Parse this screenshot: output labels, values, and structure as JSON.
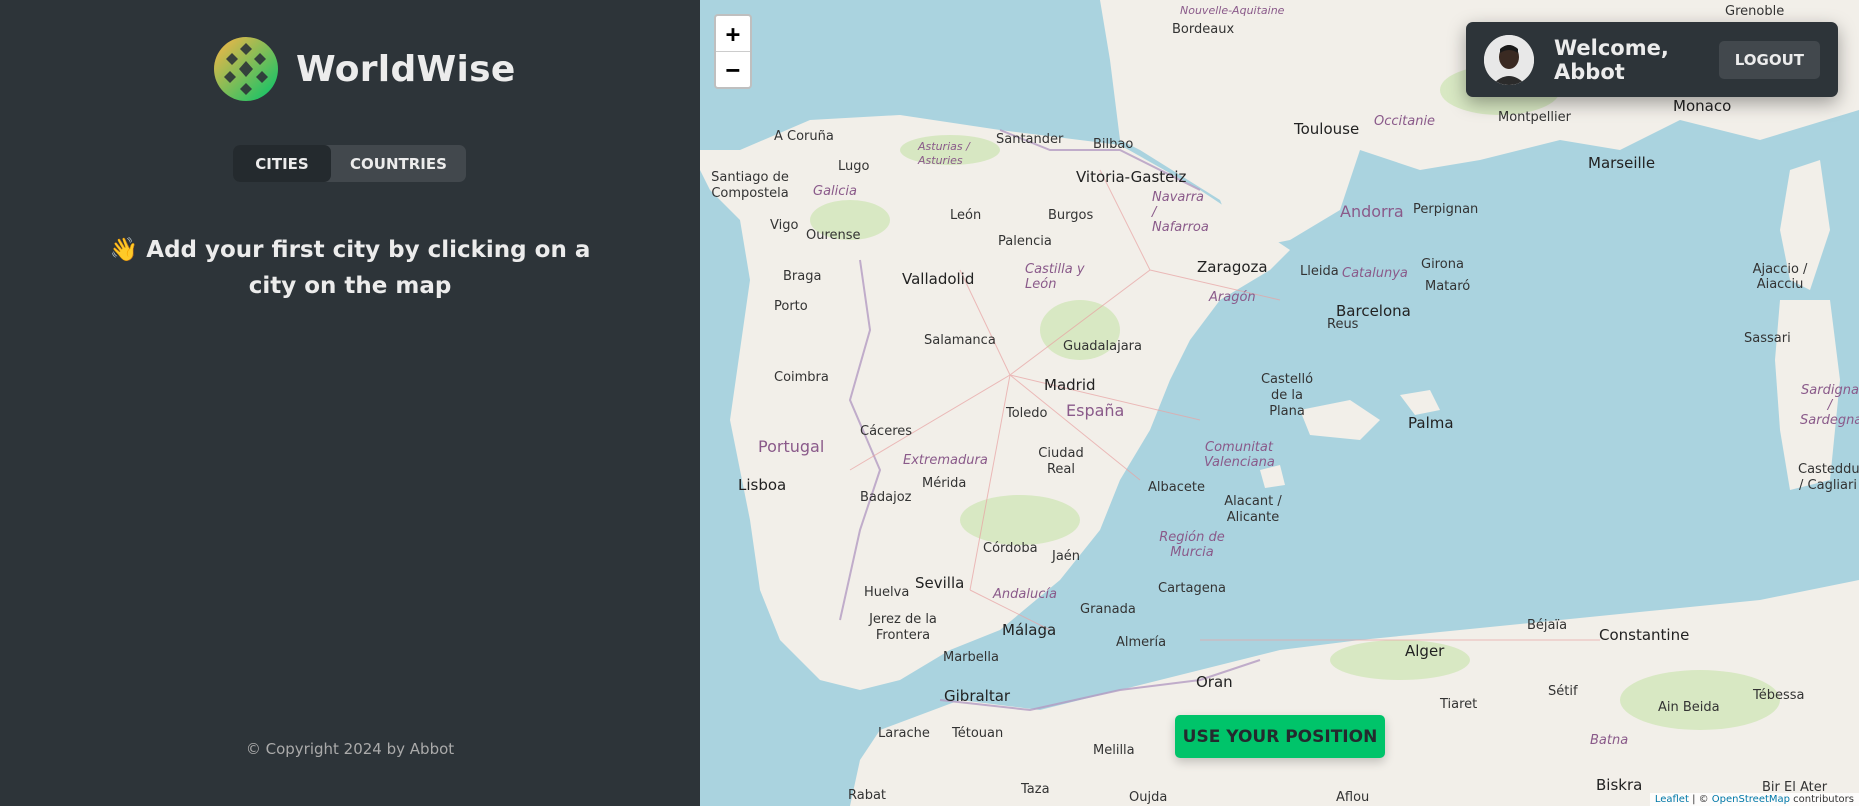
{
  "app": {
    "name": "WorldWise"
  },
  "tabs": [
    {
      "label": "Cities",
      "active": true
    },
    {
      "label": "Countries",
      "active": false
    }
  ],
  "message": {
    "emoji": "👋",
    "text": "Add your first city by clicking on a city on the map"
  },
  "footer": {
    "copyright": "© Copyright 2024 by Abbot"
  },
  "zoom": {
    "in_label": "+",
    "out_label": "−"
  },
  "user": {
    "welcome": "Welcome, Abbot",
    "logout_label": "Logout"
  },
  "position_button": {
    "label": "Use your position"
  },
  "attribution": {
    "leaflet": "Leaflet",
    "separator": " | © ",
    "osm": "OpenStreetMap",
    "suffix": " contributors"
  },
  "colors": {
    "sidebar_bg": "#2d3439",
    "tab_active_bg": "#242a2e",
    "brand_green": "#00c46a",
    "sea": "#aad3df",
    "land": "#f2efe9"
  },
  "map_labels": [
    {
      "text": "Bordeaux",
      "kind": "city"
    },
    {
      "text": "Nouvelle-Aquitaine",
      "kind": "region"
    },
    {
      "text": "Toulouse",
      "kind": "city"
    },
    {
      "text": "Occitanie",
      "kind": "region"
    },
    {
      "text": "Montpellier",
      "kind": "city"
    },
    {
      "text": "Marseille",
      "kind": "big"
    },
    {
      "text": "Monaco",
      "kind": "city"
    },
    {
      "text": "Grenoble",
      "kind": "city"
    },
    {
      "text": "A Coruña",
      "kind": "city"
    },
    {
      "text": "Lugo",
      "kind": "city"
    },
    {
      "text": "Santiago de Compostela",
      "kind": "city"
    },
    {
      "text": "Galicia",
      "kind": "region"
    },
    {
      "text": "Vigo",
      "kind": "city"
    },
    {
      "text": "Ourense",
      "kind": "city"
    },
    {
      "text": "Asturias / Asturies",
      "kind": "region"
    },
    {
      "text": "Santander",
      "kind": "city"
    },
    {
      "text": "Bilbao",
      "kind": "city"
    },
    {
      "text": "Vitoria-Gasteiz",
      "kind": "big"
    },
    {
      "text": "Navarra / Nafarroa",
      "kind": "region"
    },
    {
      "text": "Andorra",
      "kind": "country"
    },
    {
      "text": "Perpignan",
      "kind": "city"
    },
    {
      "text": "León",
      "kind": "city"
    },
    {
      "text": "Burgos",
      "kind": "city"
    },
    {
      "text": "Palencia",
      "kind": "city"
    },
    {
      "text": "Valladolid",
      "kind": "big"
    },
    {
      "text": "Castilla y León",
      "kind": "region"
    },
    {
      "text": "Zaragoza",
      "kind": "big"
    },
    {
      "text": "Aragón",
      "kind": "region"
    },
    {
      "text": "Lleida",
      "kind": "city"
    },
    {
      "text": "Catalunya",
      "kind": "region"
    },
    {
      "text": "Girona",
      "kind": "city"
    },
    {
      "text": "Mataró",
      "kind": "city"
    },
    {
      "text": "Barcelona",
      "kind": "big"
    },
    {
      "text": "Reus",
      "kind": "city"
    },
    {
      "text": "Braga",
      "kind": "city"
    },
    {
      "text": "Porto",
      "kind": "city"
    },
    {
      "text": "Salamanca",
      "kind": "city"
    },
    {
      "text": "Guadalajara",
      "kind": "city"
    },
    {
      "text": "Madrid",
      "kind": "big"
    },
    {
      "text": "España",
      "kind": "country"
    },
    {
      "text": "Toledo",
      "kind": "city"
    },
    {
      "text": "Coimbra",
      "kind": "city"
    },
    {
      "text": "Portugal",
      "kind": "country"
    },
    {
      "text": "Cáceres",
      "kind": "city"
    },
    {
      "text": "Extremadura",
      "kind": "region"
    },
    {
      "text": "Lisboa",
      "kind": "big"
    },
    {
      "text": "Mérida",
      "kind": "city"
    },
    {
      "text": "Badajoz",
      "kind": "city"
    },
    {
      "text": "Ciudad Real",
      "kind": "city"
    },
    {
      "text": "Castelló de la Plana",
      "kind": "city"
    },
    {
      "text": "Comunitat Valenciana",
      "kind": "region"
    },
    {
      "text": "Albacete",
      "kind": "city"
    },
    {
      "text": "Alacant / Alicante",
      "kind": "city"
    },
    {
      "text": "Palma",
      "kind": "big"
    },
    {
      "text": "Córdoba",
      "kind": "city"
    },
    {
      "text": "Jaén",
      "kind": "city"
    },
    {
      "text": "Región de Murcia",
      "kind": "region"
    },
    {
      "text": "Sevilla",
      "kind": "big"
    },
    {
      "text": "Andalucía",
      "kind": "region"
    },
    {
      "text": "Huelva",
      "kind": "city"
    },
    {
      "text": "Granada",
      "kind": "city"
    },
    {
      "text": "Cartagena",
      "kind": "city"
    },
    {
      "text": "Jerez de la Frontera",
      "kind": "city"
    },
    {
      "text": "Málaga",
      "kind": "big"
    },
    {
      "text": "Almería",
      "kind": "city"
    },
    {
      "text": "Marbella",
      "kind": "city"
    },
    {
      "text": "Gibraltar",
      "kind": "big"
    },
    {
      "text": "Larache",
      "kind": "city"
    },
    {
      "text": "Tétouan",
      "kind": "city"
    },
    {
      "text": "Melilla",
      "kind": "city"
    },
    {
      "text": "Oran",
      "kind": "big"
    },
    {
      "text": "Alger",
      "kind": "big"
    },
    {
      "text": "Constantine",
      "kind": "big"
    },
    {
      "text": "Béjaïa",
      "kind": "city"
    },
    {
      "text": "Sétif",
      "kind": "city"
    },
    {
      "text": "Tiaret",
      "kind": "city"
    },
    {
      "text": "Ain Beida",
      "kind": "city"
    },
    {
      "text": "Tébessa",
      "kind": "city"
    },
    {
      "text": "Batna",
      "kind": "region"
    },
    {
      "text": "Biskra",
      "kind": "city"
    },
    {
      "text": "Bir El Ater",
      "kind": "city"
    },
    {
      "text": "Rabat",
      "kind": "city"
    },
    {
      "text": "Taza",
      "kind": "city"
    },
    {
      "text": "Oujda",
      "kind": "city"
    },
    {
      "text": "Aflou",
      "kind": "city"
    },
    {
      "text": "Ajaccio / Aiacciu",
      "kind": "city"
    },
    {
      "text": "Sassari",
      "kind": "city"
    },
    {
      "text": "Sardigna / Sardegna",
      "kind": "region"
    },
    {
      "text": "Casteddu / Cagliari",
      "kind": "city"
    }
  ]
}
